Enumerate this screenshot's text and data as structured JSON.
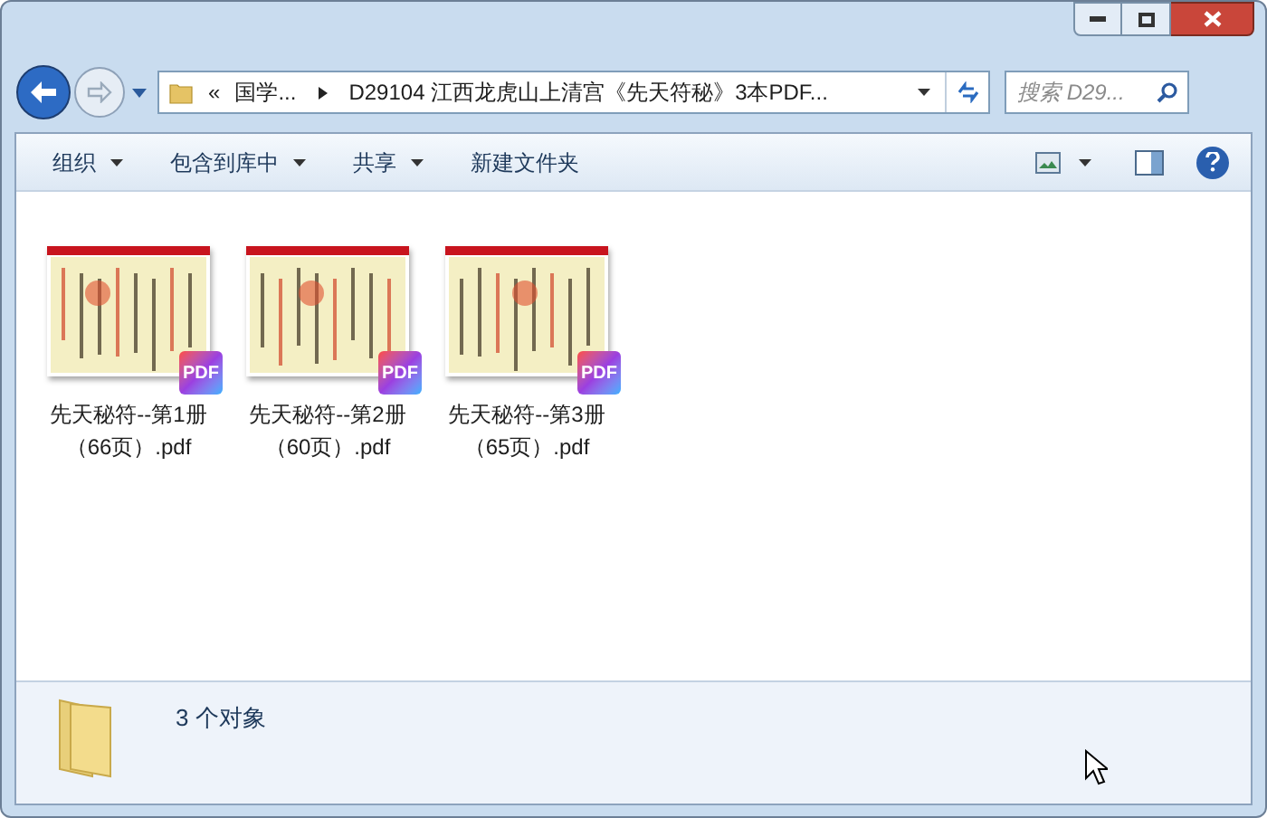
{
  "address_bar": {
    "overflow": "«",
    "segments": [
      {
        "label": "国学..."
      },
      {
        "label": "D29104 江西龙虎山上清宫《先天符秘》3本PDF..."
      }
    ]
  },
  "search": {
    "placeholder": "搜索 D29..."
  },
  "toolbar": {
    "items": [
      {
        "label": "组织",
        "has_menu": true
      },
      {
        "label": "包含到库中",
        "has_menu": true
      },
      {
        "label": "共享",
        "has_menu": true
      },
      {
        "label": "新建文件夹",
        "has_menu": false
      }
    ]
  },
  "files": [
    {
      "name": "先天秘符--第1册（66页）.pdf",
      "badge": "PDF"
    },
    {
      "name": "先天秘符--第2册（60页）.pdf",
      "badge": "PDF"
    },
    {
      "name": "先天秘符--第3册（65页）.pdf",
      "badge": "PDF"
    }
  ],
  "status_bar": {
    "text": "3 个对象"
  }
}
